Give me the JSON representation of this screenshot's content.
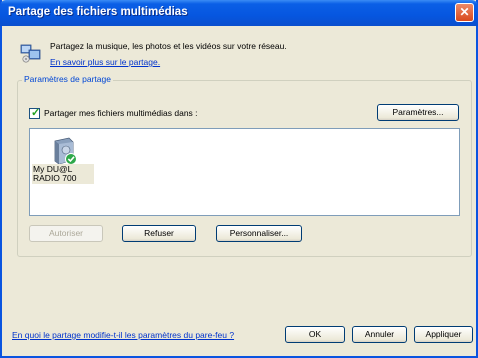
{
  "window": {
    "title": "Partage des fichiers multimédias",
    "close_glyph": "✕"
  },
  "intro": {
    "text": "Partagez la musique, les photos et les vidéos sur votre réseau.",
    "link": "En savoir plus sur le partage."
  },
  "sharing": {
    "legend": "Paramètres de partage",
    "checkbox_label": "Partager mes fichiers multimédias dans :",
    "checkbox_checked": true,
    "settings_button": "Paramètres..."
  },
  "devices": [
    {
      "label_line1": "My DU@L",
      "label_line2": "RADIO 700",
      "icon": "media-device-icon"
    }
  ],
  "device_actions": {
    "allow": "Autoriser",
    "refuse": "Refuser",
    "customize": "Personnaliser..."
  },
  "footer": {
    "firewall_link": "En quoi le partage modifie-t-il les paramètres du pare-feu ?",
    "ok": "OK",
    "cancel": "Annuler",
    "apply": "Appliquer"
  },
  "colors": {
    "titlebar": "#0656e0",
    "dialog_bg": "#ece9d8",
    "link": "#0033cc",
    "legend": "#0046d5"
  }
}
